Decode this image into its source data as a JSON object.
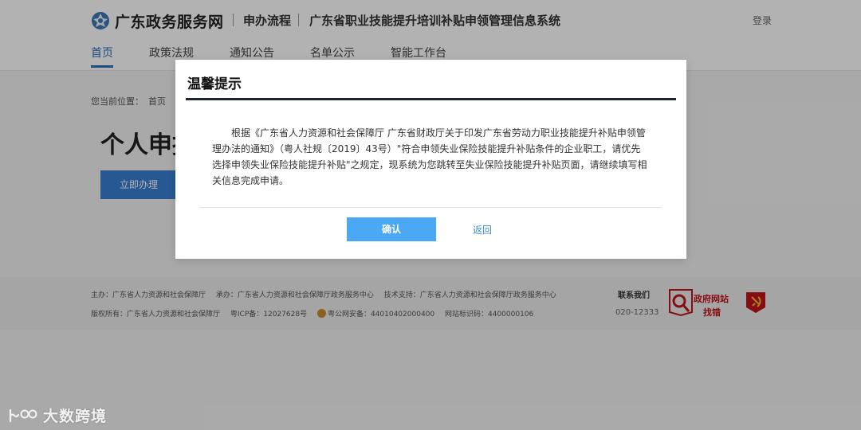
{
  "header": {
    "site_name": "广东政务服务网",
    "crumb_process": "申办流程",
    "crumb_system": "广东省职业技能提升培训补贴申领管理信息系统",
    "login": "登录",
    "nav": [
      {
        "label": "首页",
        "active": true
      },
      {
        "label": "政策法规",
        "active": false
      },
      {
        "label": "通知公告",
        "active": false
      },
      {
        "label": "名单公示",
        "active": false
      },
      {
        "label": "智能工作台",
        "active": false
      }
    ]
  },
  "main": {
    "location_prefix": "您当前位置：",
    "location_home": "首页",
    "title_visible": "个人申报",
    "apply_button": "立即办理"
  },
  "footer": {
    "host": "主办：广东省人力资源和社会保障厅",
    "organizer": "承办：广东省人力资源和社会保障厅政务服务中心",
    "tech_support": "技术支持：广东省人力资源和社会保障厅政务服务中心",
    "copyright": "版权所有：广东省人力资源和社会保障厅",
    "icp": "粤ICP备：12027628号",
    "police": "粤公网安备：44010402000400",
    "site_id": "网站标识码：4400000106",
    "contact_title": "联系我们",
    "contact_phone": "020-12333",
    "badge_line1": "政府网站",
    "badge_line2": "找错"
  },
  "modal": {
    "title": "温馨提示",
    "body": "根据《广东省人力资源和社会保障厅 广东省财政厅关于印发广东省劳动力职业技能提升补贴申领管理办法的通知》（粤人社规〔2019〕43号）\"符合申领失业保险技能提升补贴条件的企业职工，请优先选择申领失业保险技能提升补贴\"之规定，现系统为您跳转至失业保险技能提升补贴页面，请继续填写相关信息完成申请。",
    "confirm": "确认",
    "back": "返回"
  },
  "watermark": {
    "text": "大数跨境"
  },
  "colors": {
    "brand_blue": "#2d6fb8",
    "confirm_blue": "#4aa8f5",
    "link_blue": "#3d8ee0",
    "badge_red": "#c0141b"
  }
}
